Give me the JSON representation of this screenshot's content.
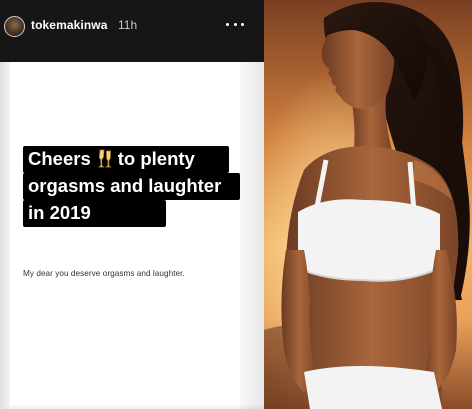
{
  "story": {
    "username": "tokemakinwa",
    "timestamp": "11h",
    "more_icon": "more-horizontal-icon",
    "caption": {
      "line1_before": "Cheers",
      "line1_after": "to plenty",
      "line1_emoji": "champagne-glasses-icon",
      "line2": "orgasms and laughter",
      "line3": "in 2019"
    },
    "quote": "My dear you deserve orgasms and laughter."
  },
  "colors": {
    "header_bg": "#161616",
    "caption_bg": "#000000",
    "caption_text": "#ffffff",
    "sunset_sky": "#e9a259",
    "swimwear": "#f3f3f3"
  }
}
